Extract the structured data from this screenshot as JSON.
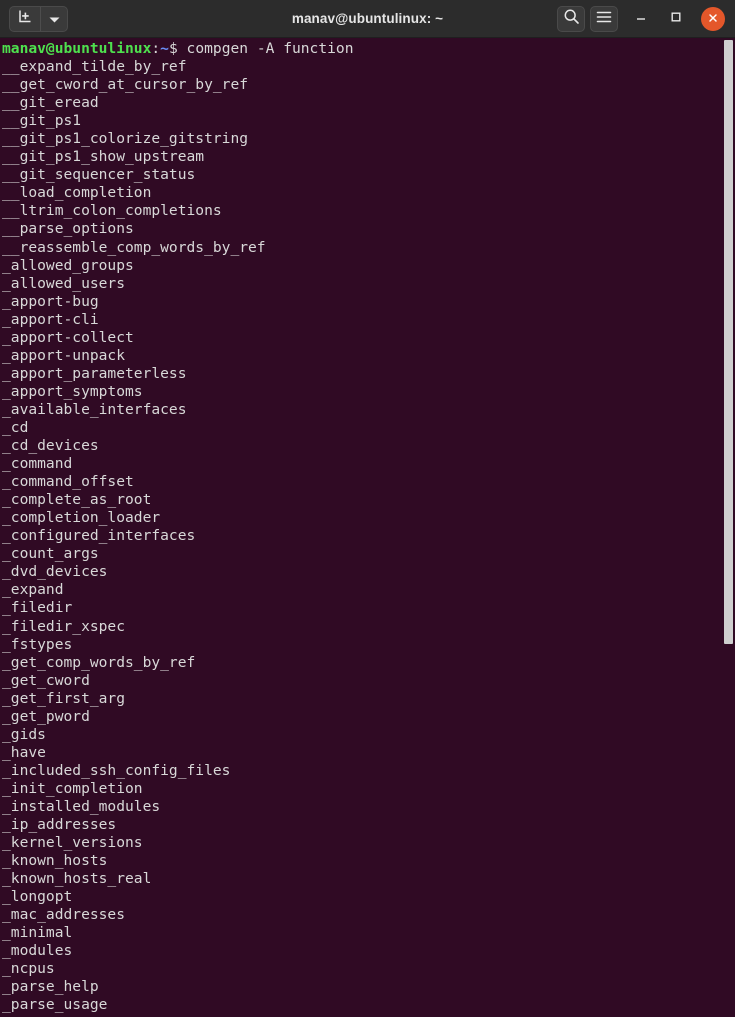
{
  "window": {
    "title": "manav@ubuntulinux: ~"
  },
  "titlebar": {
    "new_tab_label": "new-tab-icon",
    "new_tab_dropdown_label": "chevron-down-icon",
    "search_label": "search-icon",
    "menu_label": "hamburger-menu-icon",
    "minimize_label": "minimize-icon",
    "maximize_label": "maximize-icon",
    "close_label": "close-icon",
    "bg_color": "#2c2c2c",
    "close_color": "#e4572a"
  },
  "terminal": {
    "bg_color": "#300a24",
    "fg_color": "#d8d8d8",
    "prompt": {
      "user_host": "manav@ubuntulinux",
      "colon": ":",
      "path": "~",
      "dollar": "$",
      "user_host_color": "#4ee04e",
      "path_color": "#6a8df7",
      "command": " compgen -A function"
    },
    "output_lines": [
      "__expand_tilde_by_ref",
      "__get_cword_at_cursor_by_ref",
      "__git_eread",
      "__git_ps1",
      "__git_ps1_colorize_gitstring",
      "__git_ps1_show_upstream",
      "__git_sequencer_status",
      "__load_completion",
      "__ltrim_colon_completions",
      "__parse_options",
      "__reassemble_comp_words_by_ref",
      "_allowed_groups",
      "_allowed_users",
      "_apport-bug",
      "_apport-cli",
      "_apport-collect",
      "_apport-unpack",
      "_apport_parameterless",
      "_apport_symptoms",
      "_available_interfaces",
      "_cd",
      "_cd_devices",
      "_command",
      "_command_offset",
      "_complete_as_root",
      "_completion_loader",
      "_configured_interfaces",
      "_count_args",
      "_dvd_devices",
      "_expand",
      "_filedir",
      "_filedir_xspec",
      "_fstypes",
      "_get_comp_words_by_ref",
      "_get_cword",
      "_get_first_arg",
      "_get_pword",
      "_gids",
      "_have",
      "_included_ssh_config_files",
      "_init_completion",
      "_installed_modules",
      "_ip_addresses",
      "_kernel_versions",
      "_known_hosts",
      "_known_hosts_real",
      "_longopt",
      "_mac_addresses",
      "_minimal",
      "_modules",
      "_ncpus",
      "_parse_help",
      "_parse_usage"
    ]
  },
  "scrollbar": {
    "thumb_color": "#cfcfcf"
  }
}
